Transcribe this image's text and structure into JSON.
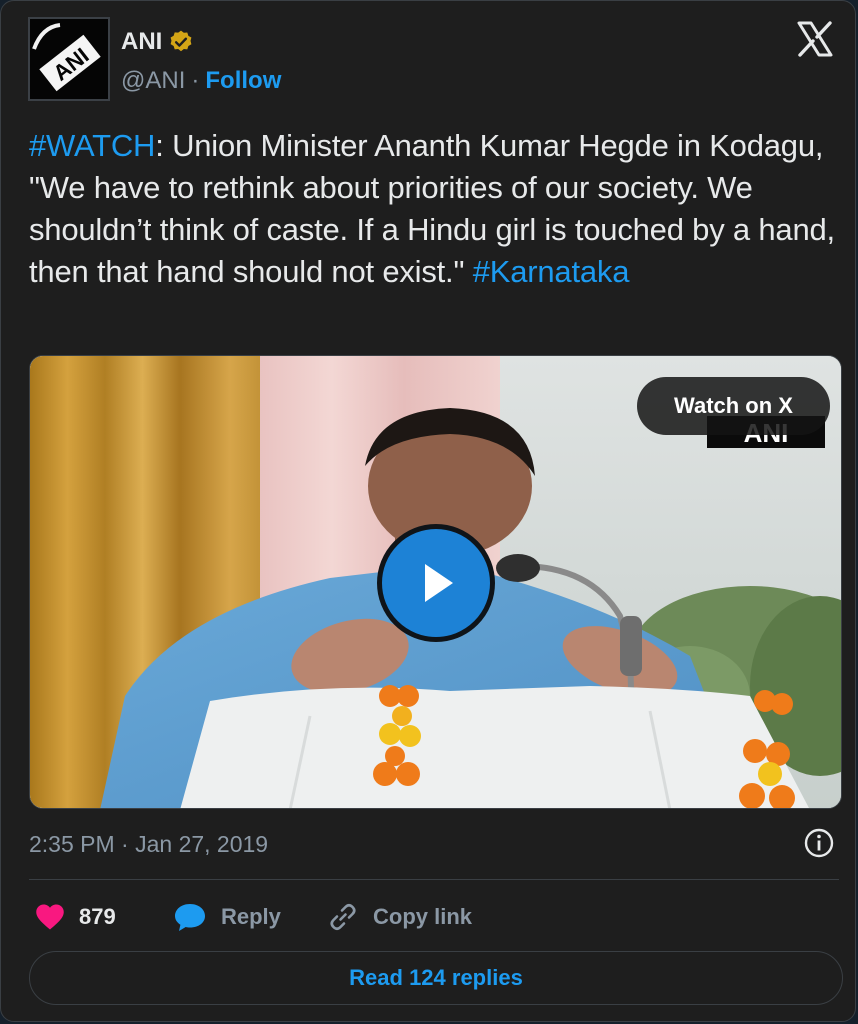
{
  "author": {
    "name": "ANI",
    "handle": "@ANI",
    "separator": "·",
    "follow_label": "Follow",
    "logo_text": "ANI",
    "verified_color": "#d4a516"
  },
  "tweet": {
    "hashtag_watch": "#WATCH",
    "body": ": Union Minister Ananth Kumar Hegde in Kodagu, \"We have to rethink about priorities of our society. We shouldn’t think of caste. If a Hindu girl is touched by a hand, then that hand should not exist.\" ",
    "hashtag_karnataka": "#Karnataka"
  },
  "media": {
    "watch_label": "Watch on X",
    "watermark_text": "ANI"
  },
  "meta": {
    "timestamp": "2:35 PM · Jan 27, 2019"
  },
  "actions": {
    "like_count": "879",
    "reply_label": "Reply",
    "copy_label": "Copy link"
  },
  "footer": {
    "read_replies_label": "Read 124 replies"
  },
  "colors": {
    "accent": "#1d9bf0",
    "like": "#f91880",
    "background": "#1e1e1e",
    "text": "#e7e9ea",
    "muted": "#8b98a5"
  },
  "icons": [
    "ani-logo-avatar",
    "verified-badge-icon",
    "x-logo-icon",
    "play-icon",
    "info-icon",
    "heart-icon",
    "reply-bubble-icon",
    "link-icon"
  ]
}
